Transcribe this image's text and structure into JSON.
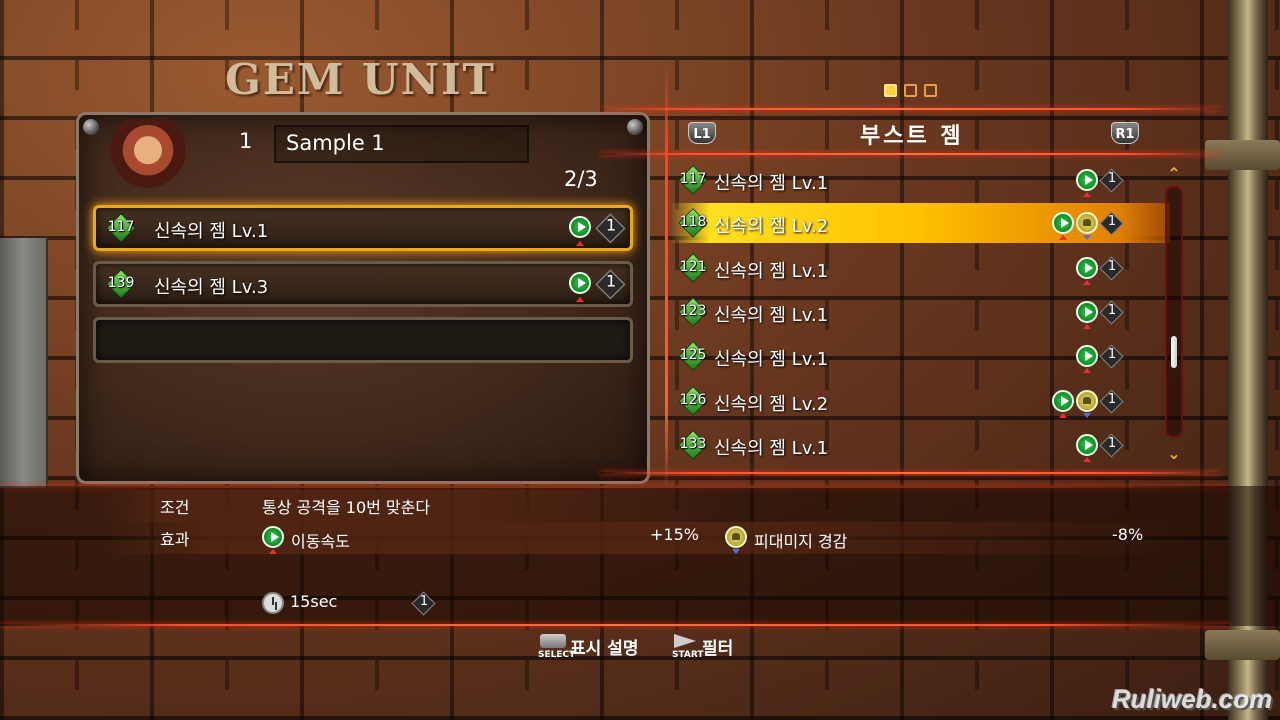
{
  "screen": {
    "title": "GEM UNIT",
    "page_dots": [
      true,
      false,
      false
    ],
    "watermark": "Ruliweb.com"
  },
  "unit": {
    "slot_number": "1",
    "name": "Sample 1",
    "count": "2/3"
  },
  "equipped": [
    {
      "gem": "117",
      "name": "신속의 젬 Lv.1",
      "cost": "1",
      "selected": true
    },
    {
      "gem": "139",
      "name": "신속의 젬 Lv.3",
      "cost": "1",
      "selected": false
    }
  ],
  "list": {
    "left_button": "L1",
    "title": "부스트 젬",
    "right_button": "R1",
    "items": [
      {
        "gem": "117",
        "name": "신속의 젬 Lv.1",
        "cost": "1",
        "icons": [
          "speed-up"
        ]
      },
      {
        "gem": "118",
        "name": "신속의 젬 Lv.2",
        "cost": "1",
        "icons": [
          "speed-up",
          "damage-down"
        ],
        "selected": true
      },
      {
        "gem": "121",
        "name": "신속의 젬 Lv.1",
        "cost": "1",
        "icons": [
          "speed-up"
        ]
      },
      {
        "gem": "123",
        "name": "신속의 젬 Lv.1",
        "cost": "1",
        "icons": [
          "speed-up"
        ]
      },
      {
        "gem": "125",
        "name": "신속의 젬 Lv.1",
        "cost": "1",
        "icons": [
          "speed-up"
        ]
      },
      {
        "gem": "126",
        "name": "신속의 젬 Lv.2",
        "cost": "1",
        "icons": [
          "speed-up",
          "damage-down"
        ]
      },
      {
        "gem": "133",
        "name": "신속의 젬 Lv.1",
        "cost": "1",
        "icons": [
          "speed-up"
        ]
      }
    ]
  },
  "detail": {
    "condition_label": "조건",
    "condition": "통상 공격을 10번 맞춘다",
    "effect_label": "효과",
    "effect1_name": "이동속도",
    "effect1_value": "+15%",
    "effect2_name": "피대미지 경감",
    "effect2_value": "-8%",
    "duration": "15sec",
    "cost": "1"
  },
  "footer": {
    "select_caption": "SELECT",
    "select_label": "표시 설명",
    "start_caption": "START",
    "start_label": "필터"
  },
  "colors": {
    "accent": "#ffc000",
    "highlight_line": "#ff5030",
    "gem": "#2aa82a"
  }
}
